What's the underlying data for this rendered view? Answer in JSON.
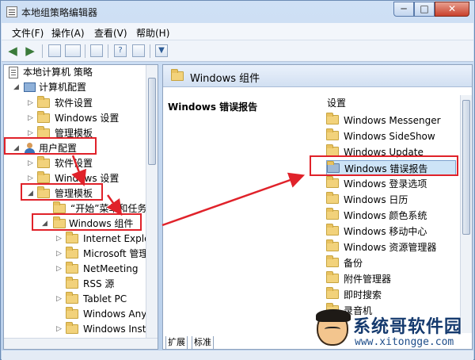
{
  "window": {
    "title": "本地组策略编辑器",
    "min_icon": "minimize-icon",
    "max_icon": "maximize-icon",
    "close_icon": "close-icon",
    "close_label": "✕",
    "min_label": "─",
    "max_label": "□"
  },
  "menu": {
    "items": [
      "文件(F)",
      "操作(A)",
      "查看(V)",
      "帮助(H)"
    ]
  },
  "toolbar": {
    "back": "◀",
    "forward": "▶",
    "icons": [
      "back-arrow-icon",
      "forward-arrow-icon",
      "up-folder-icon",
      "show-hide-tree-icon",
      "export-list-icon",
      "help-icon",
      "properties-icon",
      "filter-icon"
    ],
    "help_label": "?",
    "filter_label": "▼"
  },
  "tree": {
    "root": "本地计算机 策略",
    "computer_config": "计算机配置",
    "cc_software": "软件设置",
    "cc_windows": "Windows 设置",
    "cc_admin": "管理模板",
    "user_config": "用户配置",
    "uc_software": "软件设置",
    "uc_windows": "Windows 设置",
    "uc_admin": "管理模板",
    "start_menu": "“开始”菜单和任务",
    "windows_components": "Windows 组件",
    "children": [
      "Internet Explor",
      "Microsoft 管理",
      "NetMeeting",
      "RSS 源",
      "Tablet PC",
      "Windows Anyti",
      "Windows Insta"
    ]
  },
  "right": {
    "header": "Windows 组件",
    "extended_title": "Windows 错误报告",
    "list_header": "设置",
    "items": [
      "Windows Messenger",
      "Windows SideShow",
      "Windows Update",
      "Windows 错误报告",
      "Windows 登录选项",
      "Windows 日历",
      "Windows 颜色系统",
      "Windows 移动中心",
      "Windows 资源管理器",
      "备份",
      "附件管理器",
      "即时搜索",
      "录音机"
    ],
    "selected_index": 3
  },
  "tabs": {
    "extended": "扩展",
    "standard": "标准"
  },
  "watermark": {
    "title": "系统哥软件园",
    "url": "www.xitongge.com"
  },
  "colors": {
    "annotation_red": "#e0222a",
    "selection": "#cde4f7"
  }
}
